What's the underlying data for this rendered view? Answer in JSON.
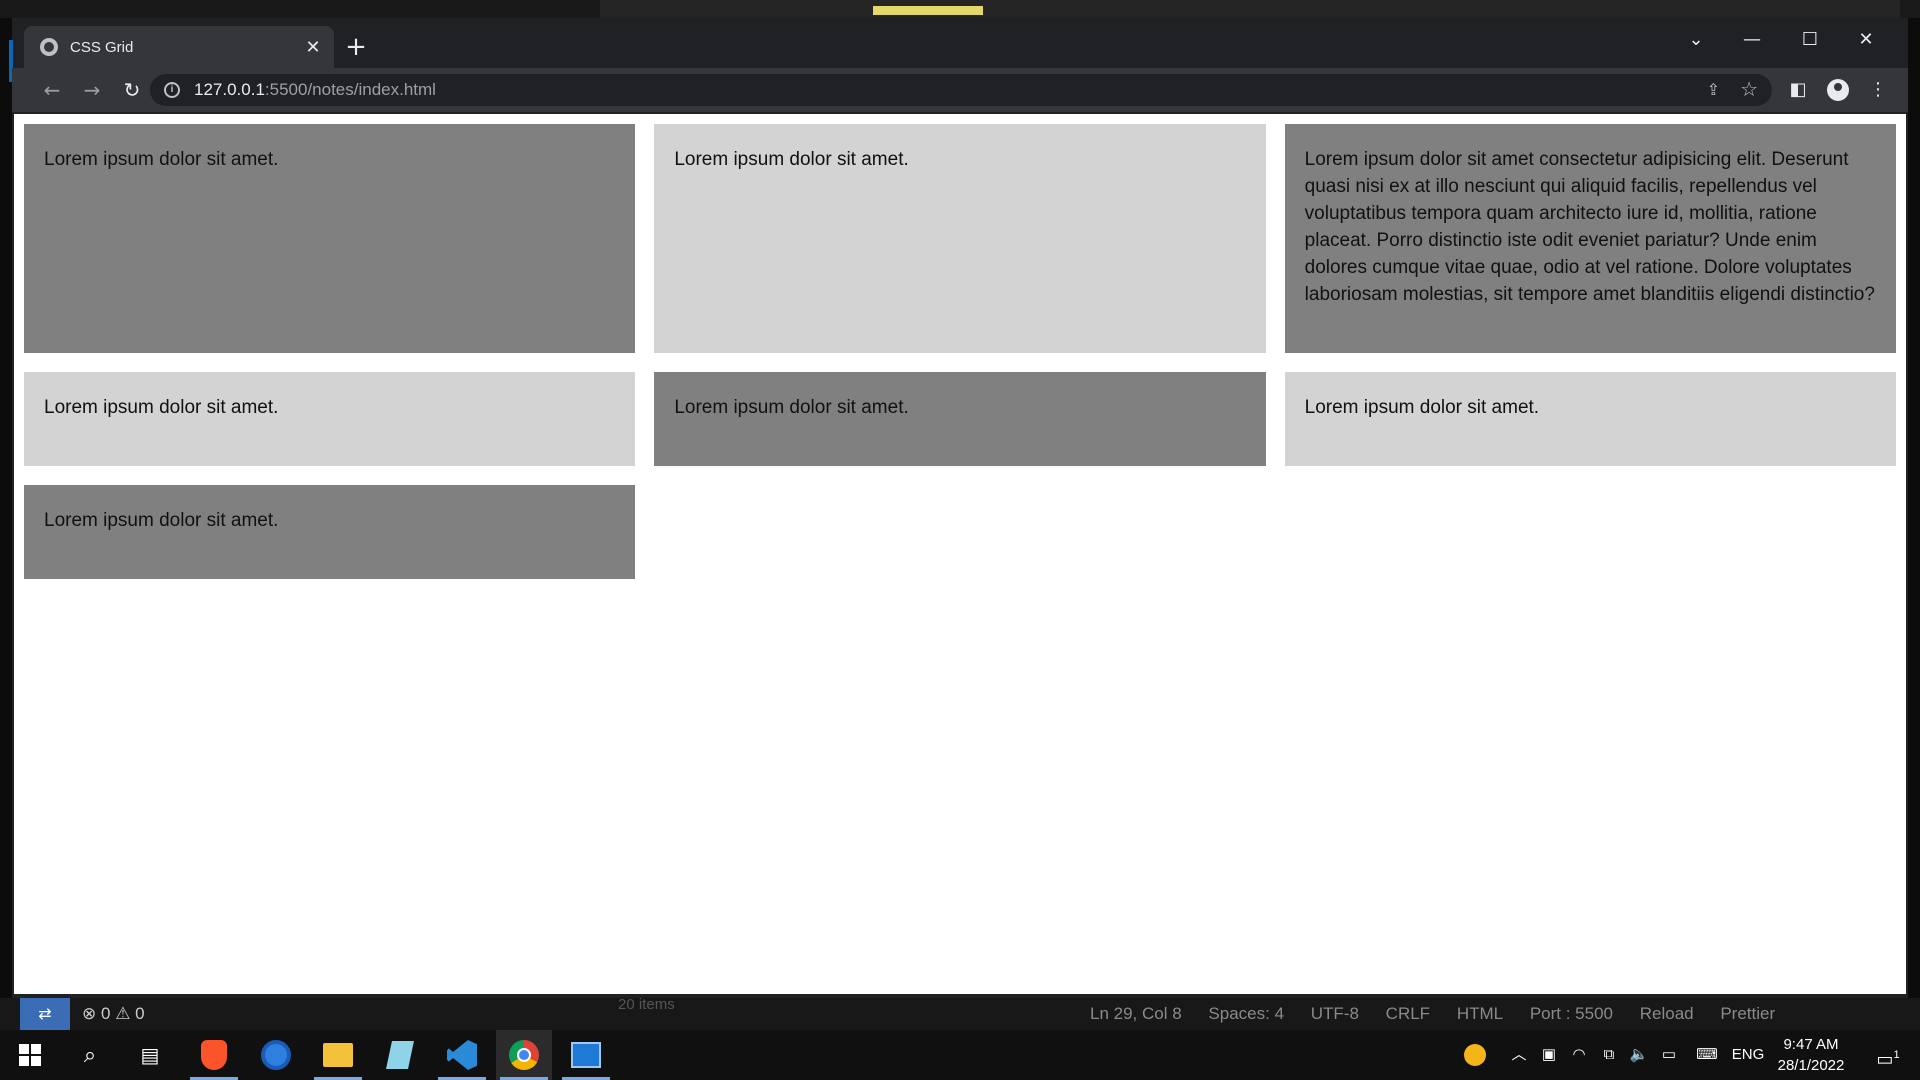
{
  "browser": {
    "tab_title": "CSS Grid",
    "url_host": "127.0.0.1",
    "url_path": ":5500/notes/index.html"
  },
  "page": {
    "items": [
      {
        "text": "Lorem ipsum dolor sit amet.",
        "shade": "dark"
      },
      {
        "text": "Lorem ipsum dolor sit amet.",
        "shade": "light"
      },
      {
        "text": "Lorem ipsum dolor sit amet consectetur adipisicing elit. Deserunt quasi nisi ex at illo nesciunt qui aliquid facilis, repellendus vel voluptatibus tempora quam architecto iure id, mollitia, ratione placeat. Porro distinctio iste odit eveniet pariatur? Unde enim dolores cumque vitae quae, odio at vel ratione. Dolore voluptates laboriosam molestias, sit tempore amet blanditiis eligendi distinctio?",
        "shade": "dark"
      },
      {
        "text": "Lorem ipsum dolor sit amet.",
        "shade": "light"
      },
      {
        "text": "Lorem ipsum dolor sit amet.",
        "shade": "dark"
      },
      {
        "text": "Lorem ipsum dolor sit amet.",
        "shade": "light"
      },
      {
        "text": "Lorem ipsum dolor sit amet.",
        "shade": "dark"
      }
    ],
    "colors": {
      "dark": "#808080",
      "light": "#d3d3d3"
    }
  },
  "vscode_status": {
    "errors": "0",
    "warnings": "0",
    "items_count": "20 items",
    "position": "Ln 29, Col 8",
    "spaces": "Spaces: 4",
    "encoding": "UTF-8",
    "eol": "CRLF",
    "language": "HTML",
    "port": "Port : 5500",
    "reload": "Reload",
    "prettier": "Prettier"
  },
  "taskbar": {
    "language": "ENG",
    "time": "9:47 AM",
    "date": "28/1/2022",
    "notification_count": "1",
    "apps": [
      "start-icon",
      "search-icon",
      "task-view-icon",
      "brave-icon",
      "firefox-icon",
      "file-explorer-icon",
      "notepad-icon",
      "vscode-icon",
      "chrome-icon",
      "photos-icon"
    ]
  }
}
